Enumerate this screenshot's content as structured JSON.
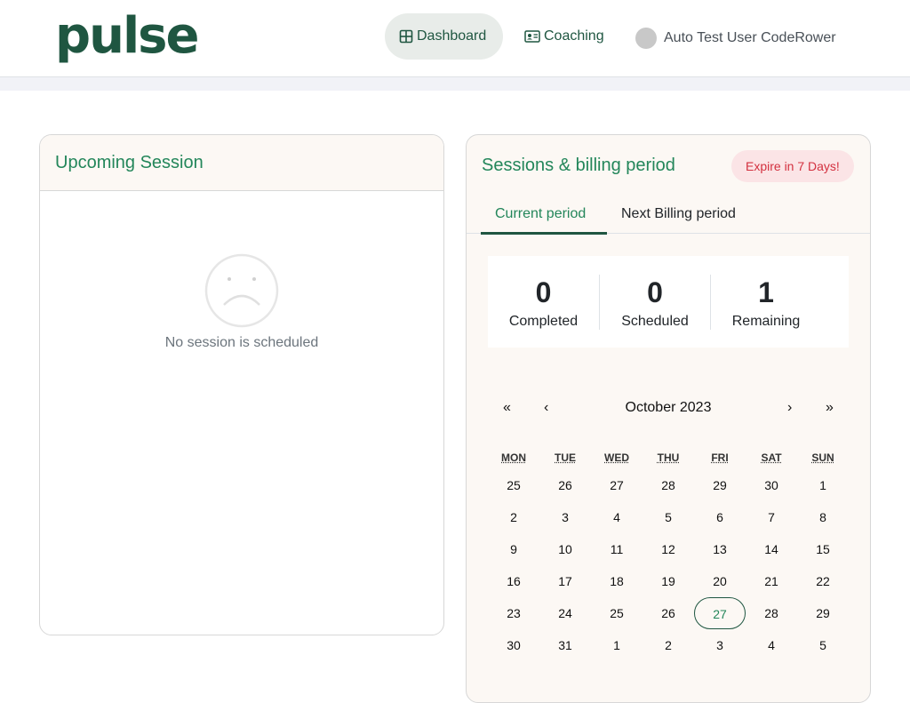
{
  "brand": {
    "logo": "pulse",
    "accent": "#1f5641",
    "green_text": "#23865a"
  },
  "nav": {
    "dashboard": {
      "label": "Dashboard",
      "icon": "grid-icon"
    },
    "coaching": {
      "label": "Coaching",
      "icon": "id-card-icon"
    }
  },
  "user": {
    "name": "Auto Test User CodeRower"
  },
  "upcoming": {
    "title": "Upcoming Session",
    "empty_text": "No session is scheduled",
    "empty_icon": "sad-face-icon"
  },
  "billing": {
    "title": "Sessions & billing period",
    "expire_badge": "Expire in 7 Days!",
    "tabs": [
      "Current period",
      "Next Billing period"
    ],
    "active_tab": "Current period",
    "stats": [
      {
        "value": "0",
        "label": "Completed"
      },
      {
        "value": "0",
        "label": "Scheduled"
      },
      {
        "value": "1",
        "label": "Remaining"
      }
    ]
  },
  "calendar": {
    "month_label": "October 2023",
    "nav": {
      "prev_year": "«",
      "prev_month": "‹",
      "next_month": "›",
      "next_year": "»"
    },
    "weekdays": [
      "MON",
      "TUE",
      "WED",
      "THU",
      "FRI",
      "SAT",
      "SUN"
    ],
    "weeks": [
      [
        "25",
        "26",
        "27",
        "28",
        "29",
        "30",
        "1"
      ],
      [
        "2",
        "3",
        "4",
        "5",
        "6",
        "7",
        "8"
      ],
      [
        "9",
        "10",
        "11",
        "12",
        "13",
        "14",
        "15"
      ],
      [
        "16",
        "17",
        "18",
        "19",
        "20",
        "21",
        "22"
      ],
      [
        "23",
        "24",
        "25",
        "26",
        "27",
        "28",
        "29"
      ],
      [
        "30",
        "31",
        "1",
        "2",
        "3",
        "4",
        "5"
      ]
    ],
    "today": "27"
  }
}
